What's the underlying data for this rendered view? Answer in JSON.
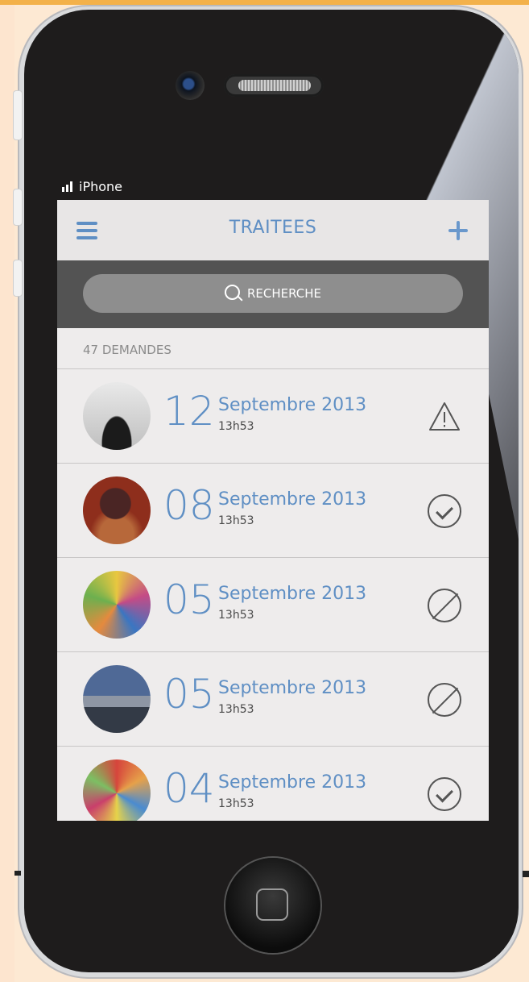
{
  "status_bar": {
    "carrier": "iPhone"
  },
  "nav": {
    "title": "TRAITEES"
  },
  "search": {
    "placeholder": "RECHERCHE"
  },
  "list": {
    "count_label": "47 DEMANDES",
    "items": [
      {
        "day": "12",
        "month": "Septembre 2013",
        "time": "13h53",
        "status_icon": "warning-icon"
      },
      {
        "day": "08",
        "month": "Septembre 2013",
        "time": "13h53",
        "status_icon": "check-icon"
      },
      {
        "day": "05",
        "month": "Septembre 2013",
        "time": "13h53",
        "status_icon": "blocked-icon"
      },
      {
        "day": "05",
        "month": "Septembre 2013",
        "time": "13h53",
        "status_icon": "blocked-icon"
      },
      {
        "day": "04",
        "month": "Septembre 2013",
        "time": "13h53",
        "status_icon": "check-icon"
      }
    ]
  },
  "colors": {
    "accent": "#5f8fc4",
    "search_bar": "#535353",
    "list_bg": "#eeecec"
  }
}
